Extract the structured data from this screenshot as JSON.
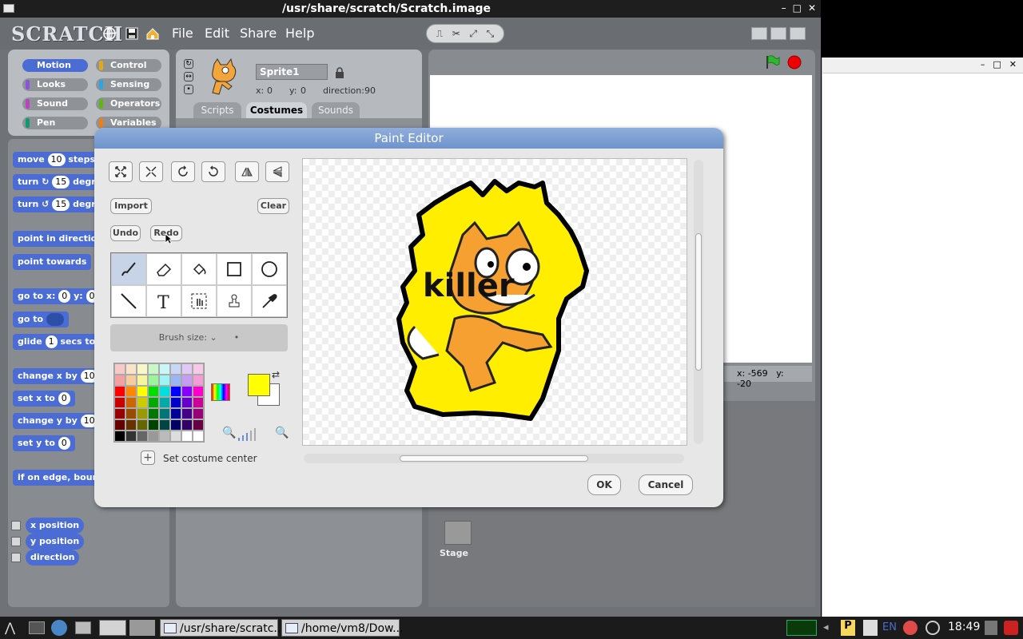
{
  "window": {
    "title": "/usr/share/scratch/Scratch.image",
    "controls": [
      "–",
      "□",
      "✕"
    ]
  },
  "menubar": {
    "logo": "SCRATCH",
    "menus": [
      "File",
      "Edit",
      "Share",
      "Help"
    ],
    "icons": [
      "globe-icon",
      "save-icon",
      "share-icon"
    ],
    "tool_icons": [
      "stamp-icon",
      "scissors-icon",
      "grow-icon",
      "shrink-icon"
    ]
  },
  "categories": [
    {
      "label": "Motion",
      "color": "#4a6cd4"
    },
    {
      "label": "Control",
      "color": "#e1a91a"
    },
    {
      "label": "Looks",
      "color": "#8a55d7"
    },
    {
      "label": "Sensing",
      "color": "#2ca5e2"
    },
    {
      "label": "Sound",
      "color": "#bb42c3"
    },
    {
      "label": "Operators",
      "color": "#5cb712"
    },
    {
      "label": "Pen",
      "color": "#0e9a6c"
    },
    {
      "label": "Variables",
      "color": "#ee7d16"
    }
  ],
  "blocks": [
    {
      "pre": "move",
      "num": "10",
      "post": "steps"
    },
    {
      "pre": "turn ↻",
      "num": "15",
      "post": "degr"
    },
    {
      "pre": "turn ↺",
      "num": "15",
      "post": "degr"
    },
    {
      "pre": "point in direction",
      "num": "",
      "post": ""
    },
    {
      "pre": "point towards",
      "num": "",
      "post": ""
    },
    {
      "pre": "go to x:",
      "num": "0",
      "post": "y:",
      "num2": "0"
    },
    {
      "pre": "go to",
      "num": "",
      "post": ""
    },
    {
      "pre": "glide",
      "num": "1",
      "post": "secs to x"
    },
    {
      "pre": "change x by",
      "num": "10",
      "post": ""
    },
    {
      "pre": "set x to",
      "num": "0",
      "post": ""
    },
    {
      "pre": "change y by",
      "num": "10",
      "post": ""
    },
    {
      "pre": "set y to",
      "num": "0",
      "post": ""
    },
    {
      "pre": "if on edge, bounce",
      "num": "",
      "post": ""
    }
  ],
  "reporters": [
    "x position",
    "y position",
    "direction"
  ],
  "sprite": {
    "name": "Sprite1",
    "x_label": "x:",
    "x": "0",
    "y_label": "y:",
    "y": "0",
    "dir_label": "direction:",
    "direction": "90"
  },
  "tabs": [
    "Scripts",
    "Costumes",
    "Sounds"
  ],
  "stage": {
    "coords_x": "x: -569",
    "coords_y": "y: -20",
    "label": "Stage"
  },
  "paint_editor": {
    "title": "Paint Editor",
    "import": "Import",
    "clear": "Clear",
    "undo": "Undo",
    "redo": "Redo",
    "brush_size": "Brush size:",
    "set_center": "Set costume center",
    "ok": "OK",
    "cancel": "Cancel",
    "canvas_text": "killer",
    "fg_color": "#ffff00",
    "bg_color": "#ffffff",
    "tools": [
      "paintbrush-icon",
      "eraser-icon",
      "fill-icon",
      "rectangle-icon",
      "ellipse-icon",
      "line-icon",
      "text-icon",
      "select-icon",
      "stamp-icon",
      "eyedropper-icon"
    ],
    "swatches": [
      "#f7c9c9",
      "#f9e3c9",
      "#f7f7c9",
      "#c9f7c9",
      "#c9f7f7",
      "#c9d6f7",
      "#e0c9f7",
      "#f7c9e8",
      "#f5a0a0",
      "#f7cc9c",
      "#f5f59c",
      "#9cf59c",
      "#9cf5f5",
      "#9cb5f5",
      "#c69cf5",
      "#f59cd8",
      "#ff0000",
      "#ff8800",
      "#ffff00",
      "#00dd00",
      "#00dddd",
      "#0000ff",
      "#8800ff",
      "#ff00cc",
      "#cc0000",
      "#cc6600",
      "#cccc00",
      "#00aa00",
      "#00aaaa",
      "#0000cc",
      "#6600cc",
      "#cc0099",
      "#990000",
      "#994c00",
      "#999900",
      "#007700",
      "#007777",
      "#000099",
      "#440088",
      "#990077",
      "#660000",
      "#663300",
      "#666600",
      "#004400",
      "#004444",
      "#000066",
      "#330066",
      "#660044",
      "#000000",
      "#333333",
      "#666666",
      "#999999",
      "#bbbbbb",
      "#dddddd",
      "#ffffff",
      "#ffffff"
    ]
  },
  "taskbar": {
    "items": [
      "/usr/share/scratc...",
      "/home/vm8/Dow..."
    ],
    "lang": "EN",
    "time": "18:49"
  }
}
